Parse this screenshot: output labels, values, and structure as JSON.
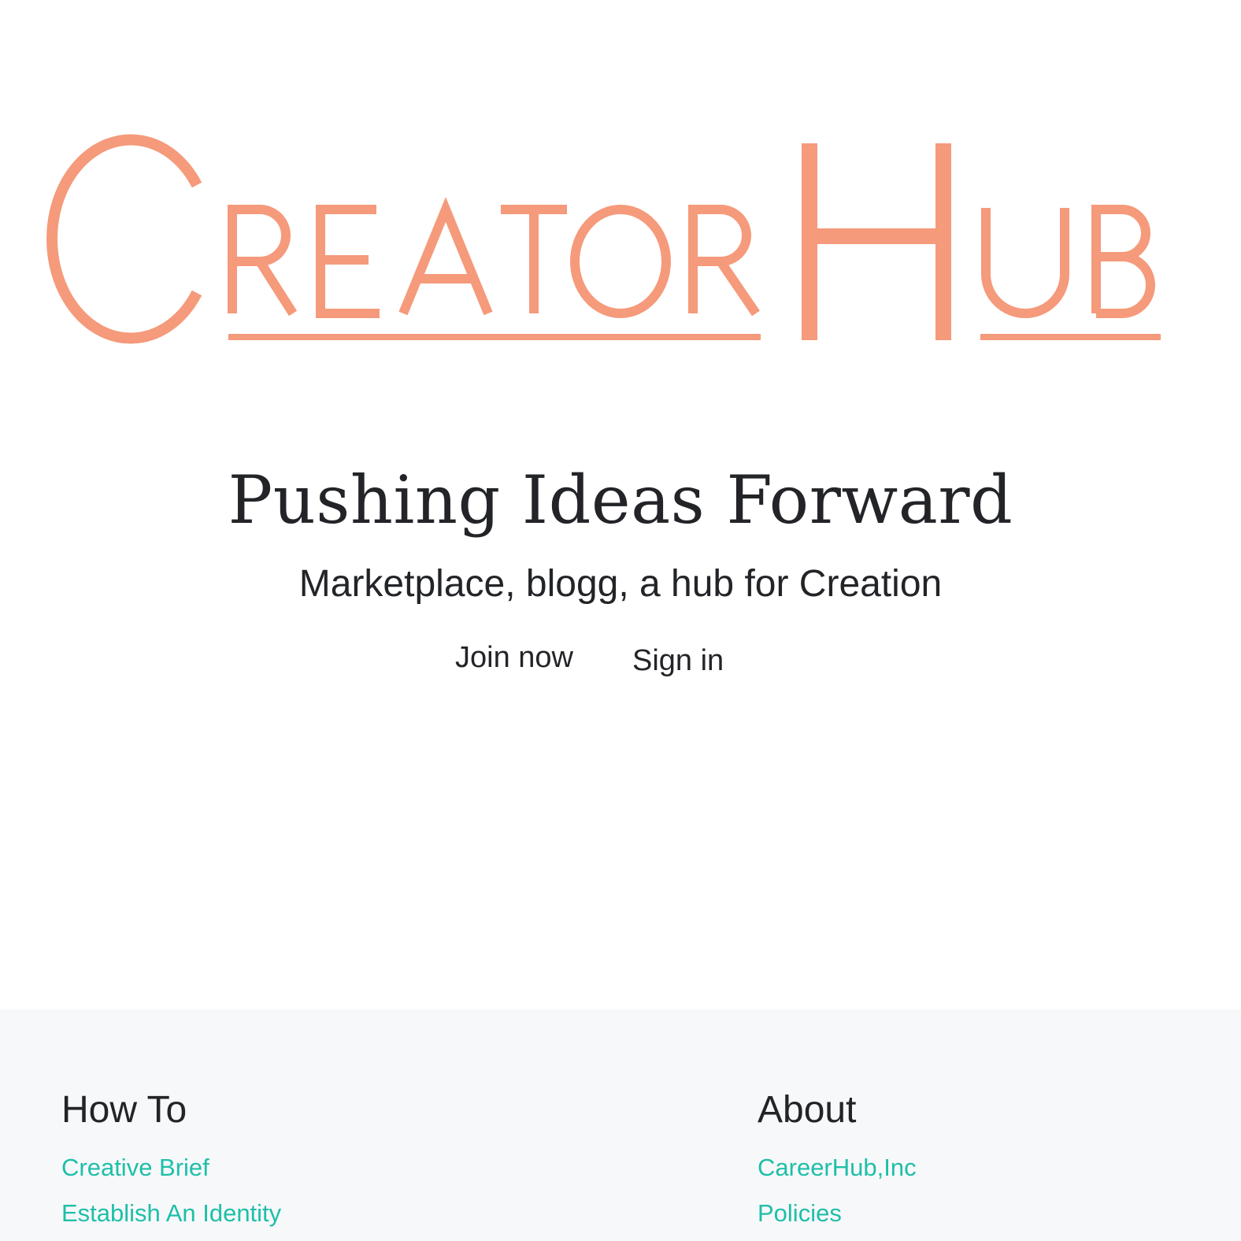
{
  "brand": {
    "logo_text": "CreatorHub",
    "logo_color": "#f59a7b"
  },
  "hero": {
    "headline": "Pushing Ideas Forward",
    "tagline": "Marketplace, blogg, a hub for Creation",
    "join_label": "Join now",
    "signin_label": "Sign in"
  },
  "footer": {
    "howto": {
      "heading": "How To",
      "links": [
        "Creative Brief",
        "Establish An Identity"
      ]
    },
    "about": {
      "heading": "About",
      "links": [
        "CareerHub,Inc",
        "Policies"
      ]
    },
    "link_color": "#1ebfa8",
    "background": "#f7f8fa"
  }
}
